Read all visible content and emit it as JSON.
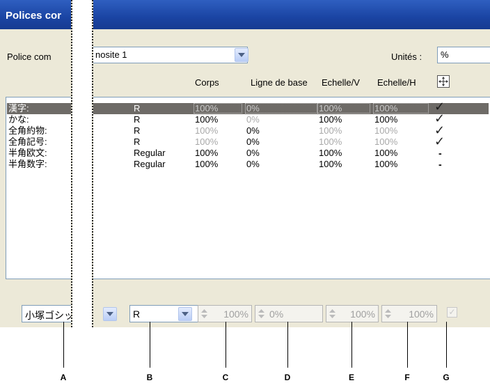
{
  "dialog": {
    "title": "Polices cor",
    "font_label": "Police com",
    "font_value": "nosite 1",
    "units_label": "Unités :",
    "units_value": "%"
  },
  "columns": {
    "corps": "Corps",
    "ligne": "Ligne de base",
    "echelle_v": "Echelle/V",
    "echelle_h": "Echelle/H"
  },
  "rows": [
    {
      "name": "漢字:",
      "style": "R",
      "corps": "100%",
      "ligne": "0%",
      "ev": "100%",
      "eh": "100%",
      "mark": "✓"
    },
    {
      "name": "かな:",
      "style": "R",
      "corps": "100%",
      "ligne": "0%",
      "ev": "100%",
      "eh": "100%",
      "mark": "✓"
    },
    {
      "name": "全角約物:",
      "style": "R",
      "corps": "100%",
      "ligne": "0%",
      "ev": "100%",
      "eh": "100%",
      "mark": "✓"
    },
    {
      "name": "全角記号:",
      "style": "R",
      "corps": "100%",
      "ligne": "0%",
      "ev": "100%",
      "eh": "100%",
      "mark": "✓"
    },
    {
      "name": "半角欧文:",
      "style": "Regular",
      "corps": "100%",
      "ligne": "0%",
      "ev": "100%",
      "eh": "100%",
      "mark": "-"
    },
    {
      "name": "半角数字:",
      "style": "Regular",
      "corps": "100%",
      "ligne": "0%",
      "ev": "100%",
      "eh": "100%",
      "mark": "-"
    }
  ],
  "controls": {
    "font_family": "小塚ゴシッ",
    "font_style": "R",
    "corps": "100%",
    "ligne": "0%",
    "echelle_v": "100%",
    "echelle_h": "100%",
    "check": "✓"
  },
  "callouts": [
    "A",
    "B",
    "C",
    "D",
    "E",
    "F",
    "G"
  ]
}
